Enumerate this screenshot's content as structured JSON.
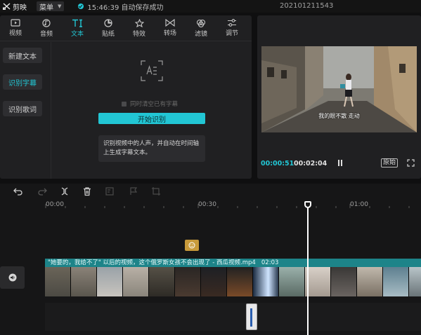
{
  "app": {
    "name": "剪映",
    "menu_label": "菜单",
    "save_status": "15:46:39 自动保存成功",
    "project_name": "202101211543",
    "accent_color": "#22c6d4"
  },
  "tabs": [
    {
      "label": "视频",
      "icon": "video-icon"
    },
    {
      "label": "音频",
      "icon": "music-icon"
    },
    {
      "label": "文本",
      "icon": "text-icon",
      "active": true
    },
    {
      "label": "贴纸",
      "icon": "sticker-icon"
    },
    {
      "label": "特效",
      "icon": "effects-icon"
    },
    {
      "label": "转场",
      "icon": "transition-icon"
    },
    {
      "label": "滤镜",
      "icon": "filter-icon"
    },
    {
      "label": "调节",
      "icon": "adjust-icon"
    }
  ],
  "side_nav": [
    {
      "label": "新建文本"
    },
    {
      "label": "识别字幕",
      "active": true
    },
    {
      "label": "识别歌词"
    }
  ],
  "recognize": {
    "clear_checkbox_label": "同时清空已有字幕",
    "start_button": "开始识别",
    "description": "识别视频中的人声，并自动在时间轴上生成字幕文本。"
  },
  "player": {
    "subtitle": "我的眼不散  走动",
    "current_time": "00:00:51",
    "total_time": "00:02:04",
    "ratio_label": "原始"
  },
  "timeline": {
    "ruler_labels": [
      "00:00",
      "00:30",
      "01:00"
    ],
    "clip_title": "\"她要的，我给不了\" 以后的视频，这个俄罗斯女孩不会出现了 - 西瓜视频.mp4",
    "clip_duration": "02:03"
  }
}
